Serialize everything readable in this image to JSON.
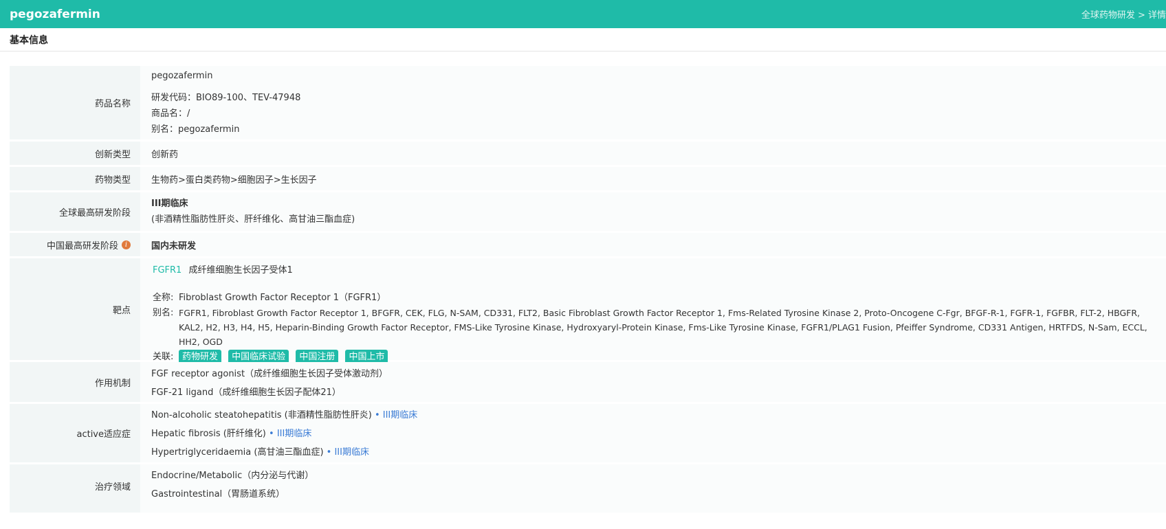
{
  "header": {
    "title": "pegozafermin",
    "breadcrumb": "全球药物研发 > 详情"
  },
  "section": {
    "title": "基本信息"
  },
  "rows": {
    "name": {
      "label": "药品名称",
      "main": "pegozafermin",
      "code": "研发代码：BIO89-100、TEV-47948",
      "trade": "商品名：/",
      "alias": "别名：pegozafermin"
    },
    "innovation": {
      "label": "创新类型",
      "value": "创新药"
    },
    "drugtype": {
      "label": "药物类型",
      "value": "生物药>蛋白类药物>细胞因子>生长因子"
    },
    "global_phase": {
      "label": "全球最高研发阶段",
      "value": "III期临床",
      "note": "(非酒精性脂肪性肝炎、肝纤维化、高甘油三酯血症)"
    },
    "china_phase": {
      "label": "中国最高研发阶段",
      "info_icon": "info-icon",
      "value": "国内未研发"
    },
    "target": {
      "label": "靶点",
      "code": "FGFR1",
      "name": "成纤维细胞生长因子受体1",
      "fullname_key": "全称:",
      "fullname": "Fibroblast Growth Factor Receptor 1（FGFR1）",
      "alias_key": "别名:",
      "alias": "FGFR1, Fibroblast Growth Factor Receptor 1, BFGFR, CEK, FLG, N-SAM, CD331, FLT2, Basic Fibroblast Growth Factor Receptor 1, Fms-Related Tyrosine Kinase 2, Proto-Oncogene C-Fgr, BFGF-R-1, FGFR-1, FGFBR, FLT-2, HBGFR, KAL2, H2, H3, H4, H5, Heparin-Binding Growth Factor Receptor, FMS-Like Tyrosine Kinase, Hydroxyaryl-Protein Kinase, Fms-Like Tyrosine Kinase, FGFR1/PLAG1 Fusion, Pfeiffer Syndrome, CD331 Antigen, HRTFDS, N-Sam, ECCL, HH2, OGD",
      "related_key": "关联:",
      "tags": [
        "药物研发",
        "中国临床试验",
        "中国注册",
        "中国上市"
      ]
    },
    "mechanism": {
      "label": "作用机制",
      "items": [
        "FGF receptor agonist（成纤维细胞生长因子受体激动剂）",
        "FGF-21 ligand（成纤维细胞生长因子配体21）"
      ]
    },
    "indications": {
      "label": "active适应症",
      "items": [
        {
          "name": "Non-alcoholic steatohepatitis (非酒精性脂肪性肝炎)",
          "phase": "• III期临床"
        },
        {
          "name": "Hepatic fibrosis (肝纤维化)",
          "phase": "• III期临床"
        },
        {
          "name": "Hypertriglyceridaemia (高甘油三酯血症)",
          "phase": "• III期临床"
        }
      ]
    },
    "therapy": {
      "label": "治疗领域",
      "items": [
        "Endocrine/Metabolic（内分泌与代谢）",
        "Gastrointestinal（胃肠道系统）"
      ]
    }
  },
  "colors": {
    "accent": "#1fbba8",
    "link_blue": "#3a7bd5",
    "info_icon": "#e07a3d"
  }
}
